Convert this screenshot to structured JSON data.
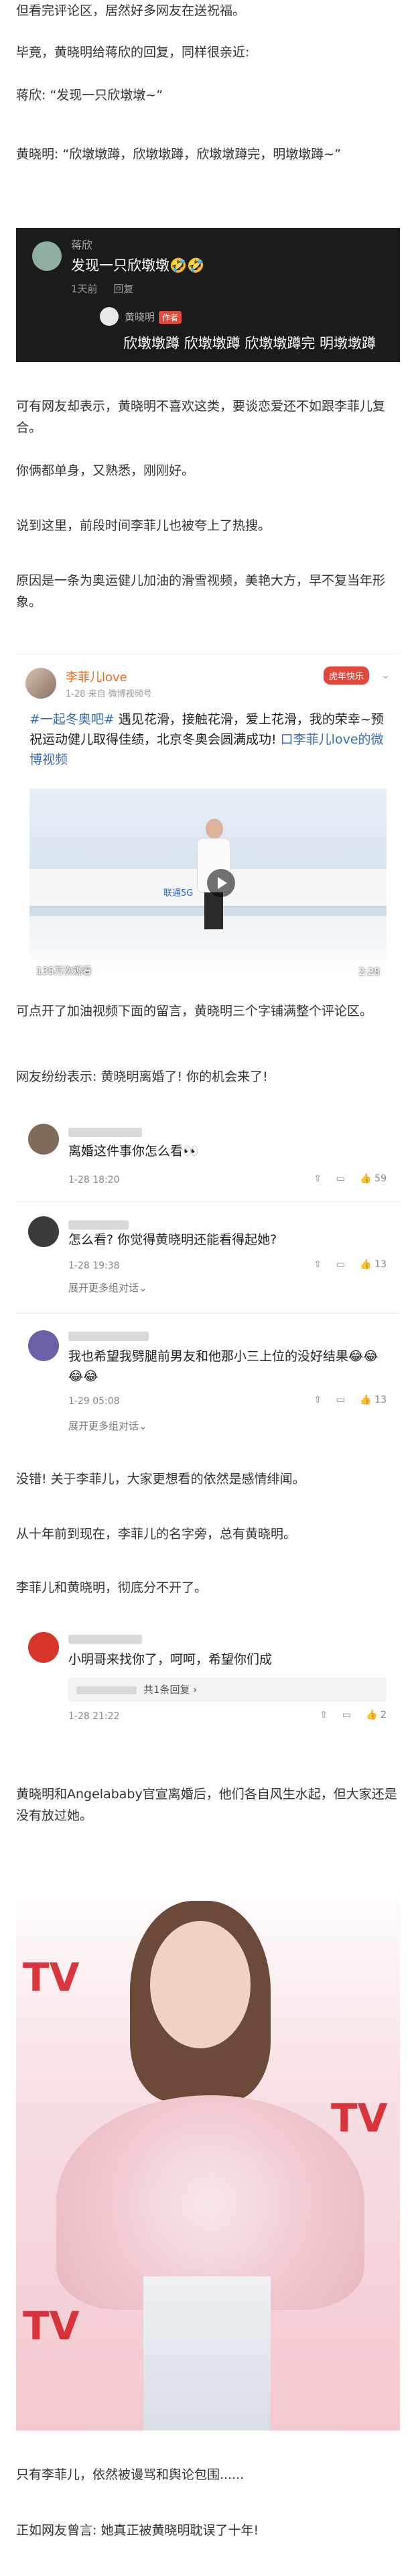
{
  "paragraphs": {
    "p1": "但看完评论区，居然好多网友在送祝福。",
    "p2": "毕竟，黄晓明给蒋欣的回复，同样很亲近:",
    "p3": "蒋欣: “发现一只欣墩墩~”",
    "p4": "黄晓明: “欣墩墩蹲，欣墩墩蹲，欣墩墩蹲完，明墩墩蹲~”",
    "p5": "可有网友却表示，黄晓明不喜欢这类，要谈恋爱还不如跟李菲儿复合。",
    "p6": "你俩都单身，又熟悉，刚刚好。",
    "p7": "说到这里，前段时间李菲儿也被夸上了热搜。",
    "p8": "原因是一条为奥运健儿加油的滑雪视频，美艳大方，早不复当年形象。",
    "p9": "可点开了加油视频下面的留言，黄晓明三个字铺满整个评论区。",
    "p10": "网友纷纷表示: 黄晓明离婚了! 你的机会来了!",
    "p11": "没错! 关于李菲儿，大家更想看的依然是感情绯闻。",
    "p12": "从十年前到现在，李菲儿的名字旁，总有黄晓明。",
    "p13": "李菲儿和黄晓明，彻底分不开了。",
    "p14": "黄晓明和Angelababy官宣离婚后，他们各自风生水起，但大家还是没有放过她。",
    "p15": "只有李菲儿，依然被谩骂和舆论包围......",
    "p16": "正如网友曾言: 她真正被黄晓明耽误了十年!"
  },
  "dark_comment": {
    "user": "蒋欣",
    "text": "发现一只欣墩墩🤣🤣",
    "time": "1天前",
    "reply_label": "回复",
    "reply_user": "黄晓明",
    "author_tag": "作者",
    "reply_text": "欣墩墩蹲 欣墩墩蹲 欣墩墩蹲完 明墩墩蹲"
  },
  "post": {
    "name": "李菲儿love",
    "meta": "1-28  来自 微博视频号",
    "badge": "虎年快乐",
    "body_hashtag": "#一起冬奥吧#",
    "body_text": " 遇见花滑，接触花滑，爱上花滑，我的荣幸~预祝运动健儿取得佳绩，北京冬奥会圆满成功! ",
    "body_link": "口李菲儿love的微博视频",
    "views": "135万次观看",
    "duration": "2:28",
    "brand": "联通5G"
  },
  "comments": [
    {
      "text": "离婚这件事你怎么看👀",
      "time": "1-28 18:20",
      "likes": "59"
    },
    {
      "text": "怎么看? 你觉得黄晓明还能看得起她?",
      "time": "1-28 19:38",
      "likes": "13",
      "more": "展开更多组对话⌄"
    },
    {
      "text": "我也希望我劈腿前男友和他那小三上位的没好结果😂😂😂😂",
      "time": "1-29 05:08",
      "likes": "13",
      "more": "展开更多组对话⌄"
    },
    {
      "text": "小明哥来找你了，呵呵，希望你们成",
      "time": "1-28 21:22",
      "likes": "2",
      "reply_summary": "共1条回复 ›"
    }
  ],
  "photo": {
    "bg_text": "TV"
  }
}
